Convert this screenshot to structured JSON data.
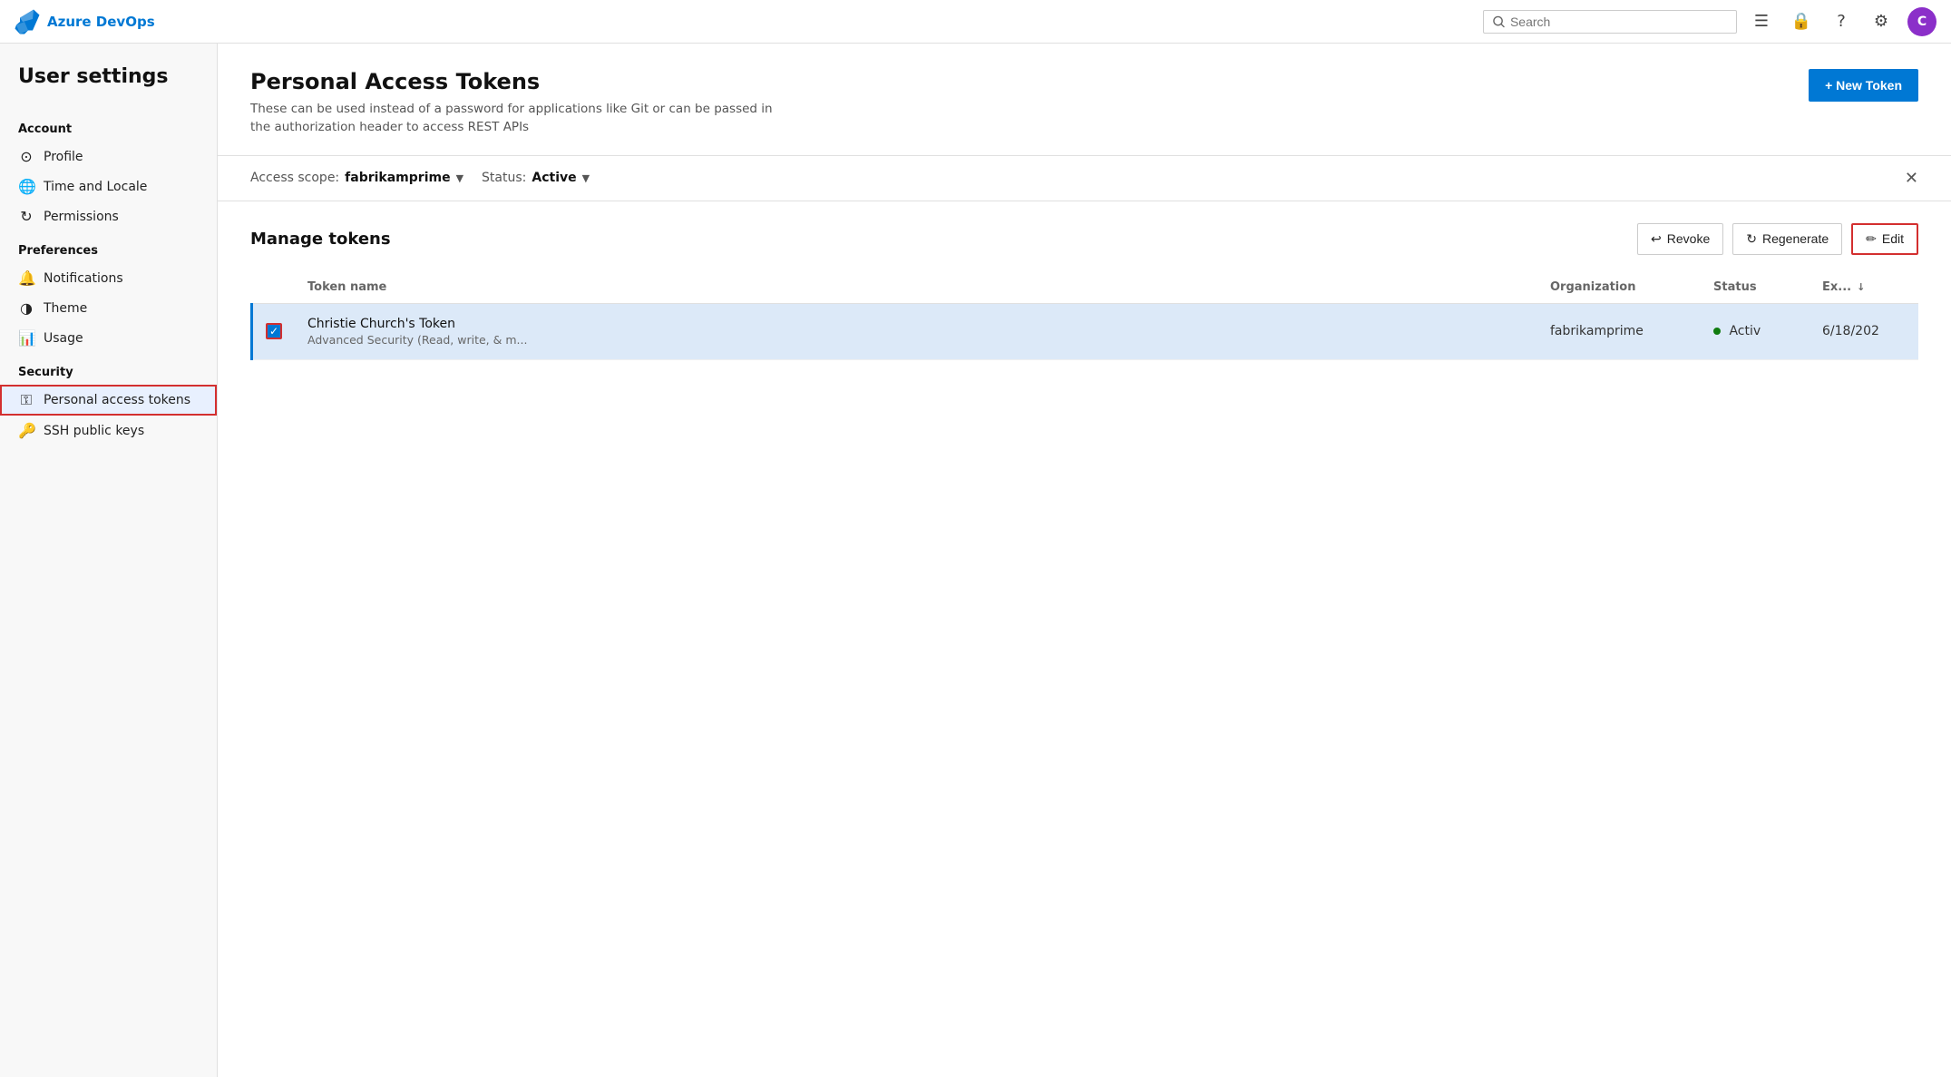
{
  "app": {
    "name": "Azure DevOps",
    "logo_aria": "Azure DevOps logo"
  },
  "topnav": {
    "search_placeholder": "Search",
    "icons": [
      "task-list-icon",
      "lock-icon",
      "help-icon",
      "settings-icon"
    ],
    "avatar_initials": "C"
  },
  "sidebar": {
    "title": "User settings",
    "sections": [
      {
        "label": "Account",
        "items": [
          {
            "id": "profile",
            "label": "Profile",
            "icon": "person-icon"
          },
          {
            "id": "time-locale",
            "label": "Time and Locale",
            "icon": "globe-icon"
          },
          {
            "id": "permissions",
            "label": "Permissions",
            "icon": "permissions-icon"
          }
        ]
      },
      {
        "label": "Preferences",
        "items": [
          {
            "id": "notifications",
            "label": "Notifications",
            "icon": "bell-icon"
          },
          {
            "id": "theme",
            "label": "Theme",
            "icon": "theme-icon"
          },
          {
            "id": "usage",
            "label": "Usage",
            "icon": "usage-icon"
          }
        ]
      },
      {
        "label": "Security",
        "items": [
          {
            "id": "personal-access-tokens",
            "label": "Personal access tokens",
            "icon": "key-icon",
            "active": true
          },
          {
            "id": "ssh-public-keys",
            "label": "SSH public keys",
            "icon": "ssh-icon"
          }
        ]
      }
    ]
  },
  "page": {
    "title": "Personal Access Tokens",
    "description": "These can be used instead of a password for applications like Git or can be passed in the authorization header to access REST APIs",
    "new_token_label": "+ New Token"
  },
  "filter_bar": {
    "scope_label": "Access scope:",
    "scope_value": "fabrikamprime",
    "status_label": "Status:",
    "status_value": "Active"
  },
  "manage_tokens": {
    "title": "Manage tokens",
    "revoke_label": "Revoke",
    "regenerate_label": "Regenerate",
    "edit_label": "Edit"
  },
  "table": {
    "columns": [
      {
        "id": "check",
        "label": ""
      },
      {
        "id": "name",
        "label": "Token name"
      },
      {
        "id": "org",
        "label": "Organization"
      },
      {
        "id": "status",
        "label": "Status"
      },
      {
        "id": "exp",
        "label": "Ex...",
        "sortable": true
      }
    ],
    "rows": [
      {
        "selected": true,
        "token_name": "Christie Church's Token",
        "token_scope": "Advanced Security (Read, write, & m...",
        "organization": "fabrikamprime",
        "status": "Activ",
        "status_active": true,
        "expiry": "6/18/202"
      }
    ]
  }
}
